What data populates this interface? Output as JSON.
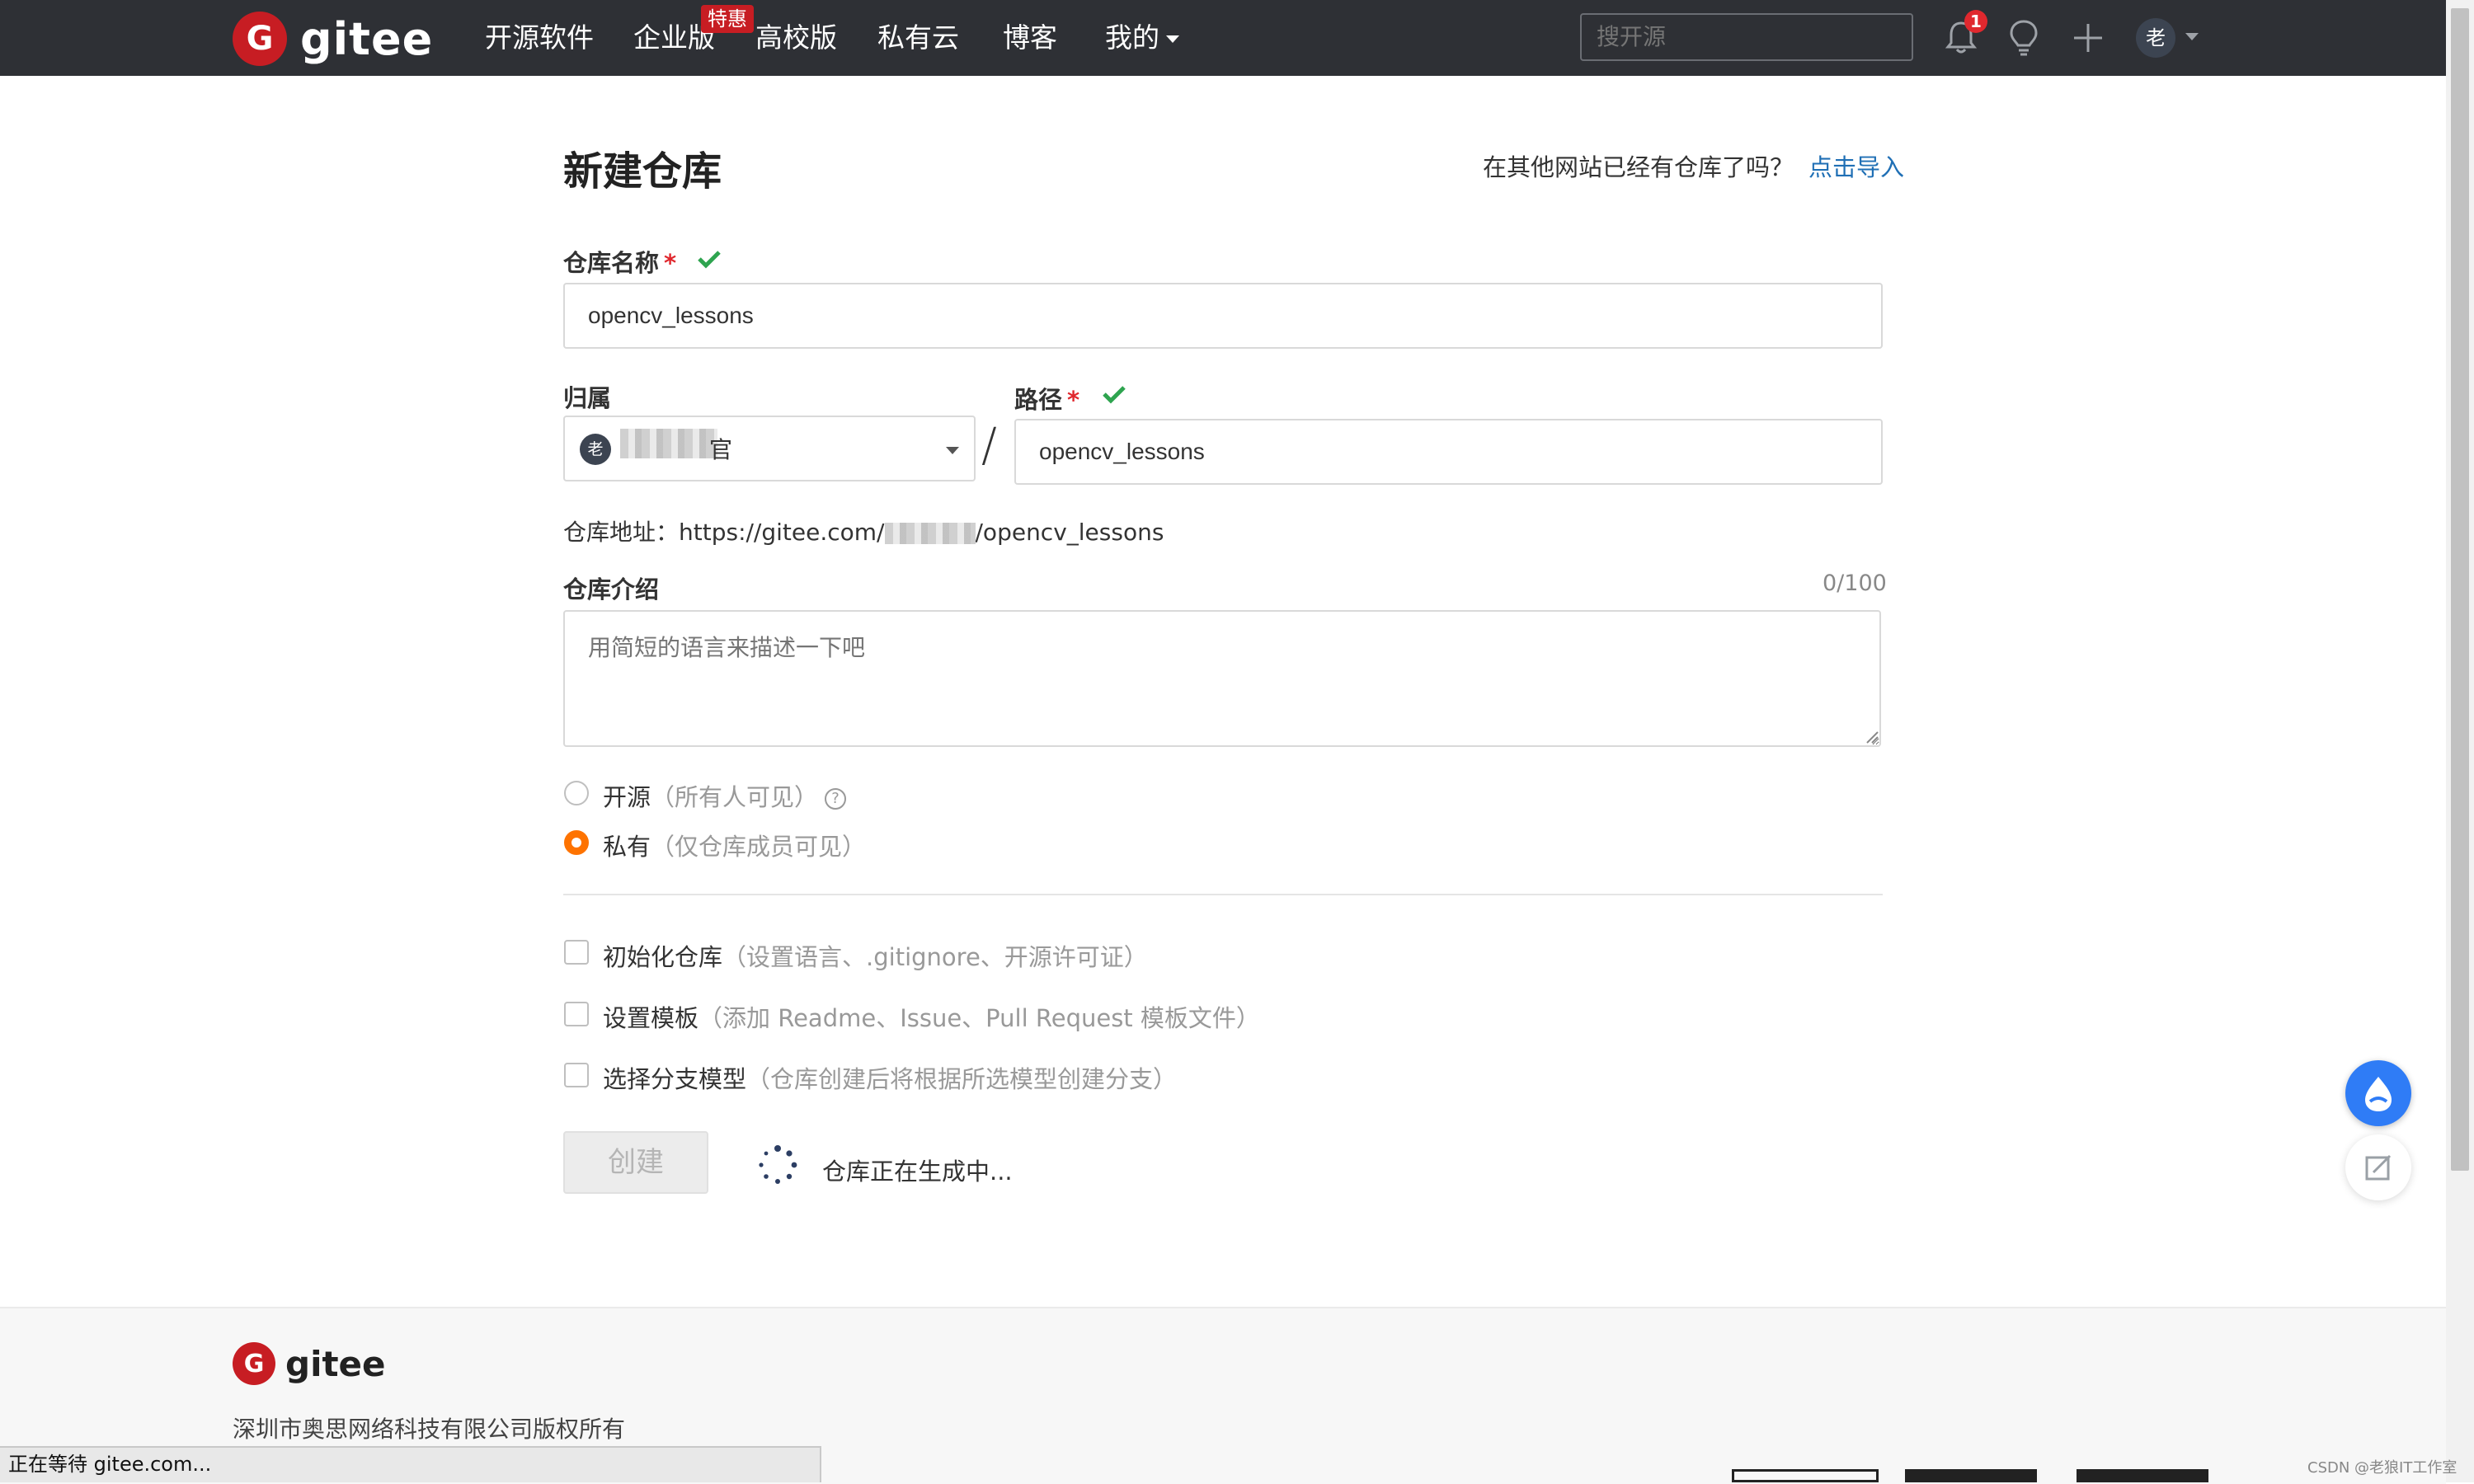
{
  "nav": {
    "logo_text": "gitee",
    "items": [
      "开源软件",
      "企业版",
      "高校版",
      "私有云",
      "博客",
      "我的"
    ],
    "enterprise_badge": "特惠",
    "search_placeholder": "搜开源",
    "notification_count": "1",
    "avatar_initial": "老"
  },
  "form": {
    "title": "新建仓库",
    "import_prompt": "在其他网站已经有仓库了吗？",
    "import_link": "点击导入",
    "repo_name_label": "仓库名称",
    "required_mark": "*",
    "repo_name_value": "opencv_lessons",
    "owner_label": "归属",
    "owner_avatar": "老",
    "owner_name_tail": "官",
    "path_label": "路径",
    "path_value": "opencv_lessons",
    "separator": "/",
    "repo_url_prefix": "仓库地址：https://gitee.com/",
    "repo_url_suffix": "/opencv_lessons",
    "description_label": "仓库介绍",
    "description_counter": "0/100",
    "description_placeholder": "用简短的语言来描述一下吧",
    "visibility": [
      {
        "label": "开源",
        "hint": "（所有人可见）",
        "selected": false
      },
      {
        "label": "私有",
        "hint": "（仅仓库成员可见）",
        "selected": true
      }
    ],
    "help_glyph": "?",
    "options": [
      {
        "label": "初始化仓库",
        "hint": "（设置语言、.gitignore、开源许可证）",
        "checked": false
      },
      {
        "label": "设置模板",
        "hint": "（添加 Readme、Issue、Pull Request 模板文件）",
        "checked": false
      },
      {
        "label": "选择分支模型",
        "hint": "（仓库创建后将根据所选模型创建分支）",
        "checked": false
      }
    ],
    "create_button": "创建",
    "status_text": "仓库正在生成中..."
  },
  "footer": {
    "logo_text": "gitee",
    "copyright": "深圳市奥思网络科技有限公司版权所有"
  },
  "browser_status": "正在等待 gitee.com...",
  "watermark": "CSDN @老狼IT工作室",
  "colors": {
    "nav_bg": "#2e3035",
    "brand_red": "#c71d23",
    "link_blue": "#1f6fb5",
    "radio_orange": "#fe7300",
    "check_green": "#2ea44f"
  }
}
